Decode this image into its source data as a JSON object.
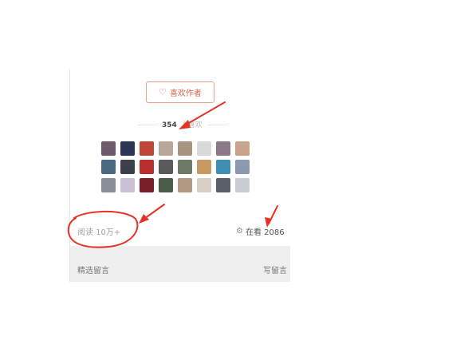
{
  "like_author": {
    "label": "喜欢作者",
    "icon": "heart-gift-icon"
  },
  "likers": {
    "count": "354",
    "suffix": "人喜欢",
    "avatar_colors": [
      "#6d5b6a",
      "#2b3556",
      "#c0463a",
      "#b9a79a",
      "#a89480",
      "#d9d9d9",
      "#8a7a88",
      "#c9a38c",
      "#4a6a84",
      "#3c4048",
      "#b8302e",
      "#5a5a5a",
      "#6c7a66",
      "#c79a64",
      "#3f8eb3",
      "#8c9ab0",
      "#8a8e98",
      "#c9c2d6",
      "#7a1f2a",
      "#4c5e4a",
      "#b29a80",
      "#d8d0c6",
      "#5a5f6a",
      "#c9ccd2"
    ]
  },
  "stats": {
    "reads": "阅读 10万+",
    "watching": "在看 2086",
    "watching_icon": "gear-icon"
  },
  "footer": {
    "left": "精选留言",
    "right": "写留言"
  },
  "colors": {
    "accent": "#d8634c",
    "annotation": "#e53225"
  }
}
